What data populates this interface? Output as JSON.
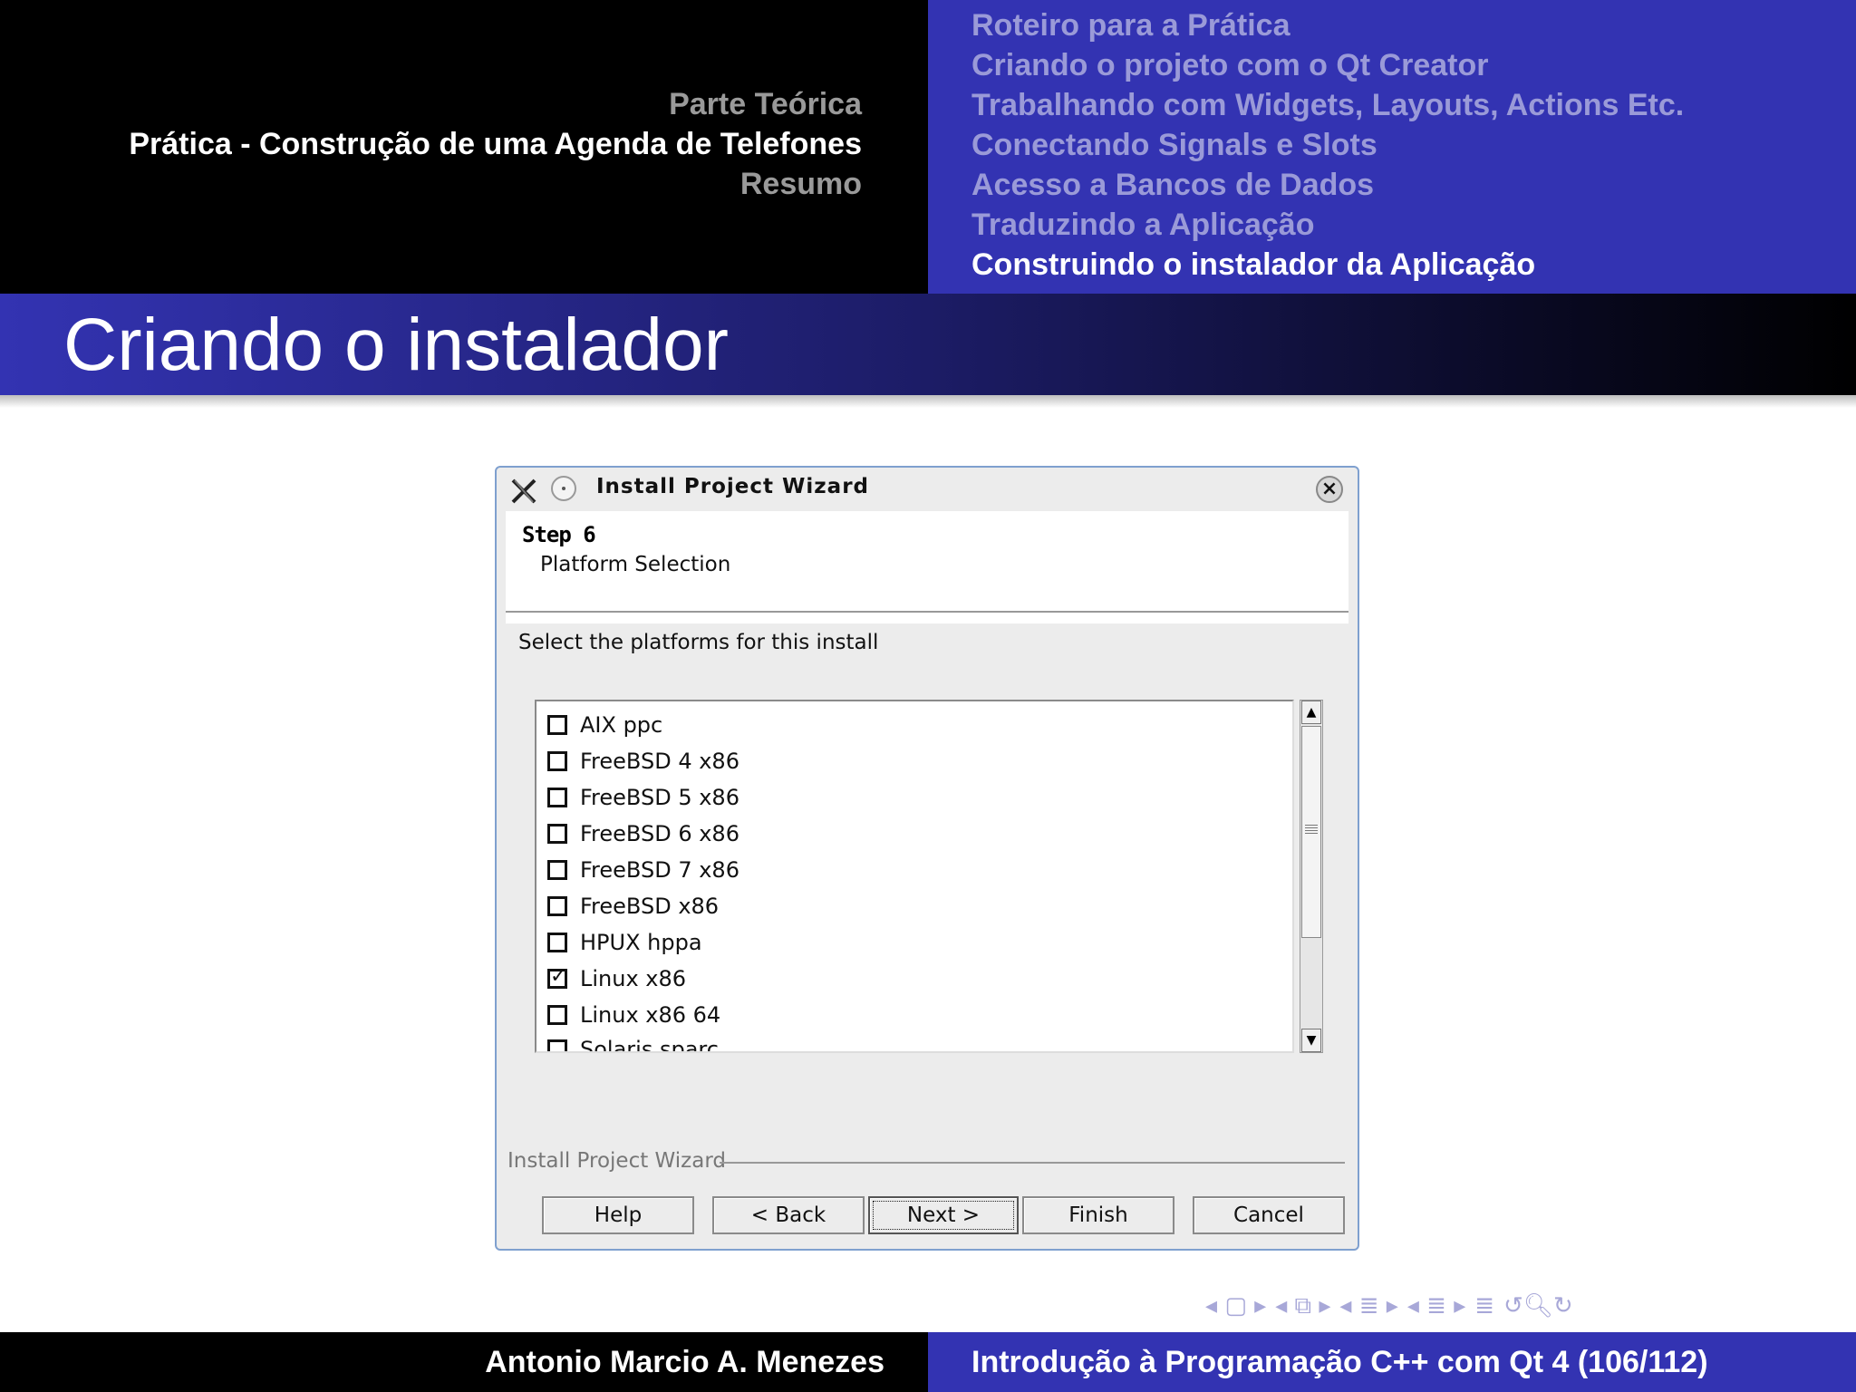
{
  "header": {
    "sections": [
      {
        "label": "Parte Teórica",
        "active": false
      },
      {
        "label": "Prática - Construção de uma Agenda de Telefones",
        "active": true
      },
      {
        "label": "Resumo",
        "active": false
      }
    ],
    "subsections": [
      {
        "label": "Roteiro para a Prática",
        "active": false
      },
      {
        "label": "Criando o projeto com o Qt Creator",
        "active": false
      },
      {
        "label": "Trabalhando com Widgets, Layouts, Actions Etc.",
        "active": false
      },
      {
        "label": "Conectando Signals e Slots",
        "active": false
      },
      {
        "label": "Acesso a Bancos de Dados",
        "active": false
      },
      {
        "label": "Traduzindo a Aplicação",
        "active": false
      },
      {
        "label": "Construindo o instalador da Aplicação",
        "active": true
      }
    ]
  },
  "frame": {
    "title": "Criando o instalador"
  },
  "dialog": {
    "title": "Install Project Wizard",
    "step_title": "Step 6",
    "step_subtitle": "Platform Selection",
    "prompt": "Select the platforms for this install",
    "platforms": [
      {
        "label": "AIX ppc",
        "checked": false
      },
      {
        "label": "FreeBSD 4 x86",
        "checked": false
      },
      {
        "label": "FreeBSD 5 x86",
        "checked": false
      },
      {
        "label": "FreeBSD 6 x86",
        "checked": false
      },
      {
        "label": "FreeBSD 7 x86",
        "checked": false
      },
      {
        "label": "FreeBSD x86",
        "checked": false
      },
      {
        "label": "HPUX hppa",
        "checked": false
      },
      {
        "label": "Linux x86",
        "checked": true
      },
      {
        "label": "Linux x86 64",
        "checked": false
      },
      {
        "label": "Solaris sparc",
        "checked": false
      }
    ],
    "group_label": "Install Project Wizard",
    "buttons": {
      "help": "Help",
      "back": "< Back",
      "next": "Next >",
      "finish": "Finish",
      "cancel": "Cancel"
    }
  },
  "footer": {
    "author": "Antonio Marcio A. Menezes",
    "title": "Introdução à Programação C++ com Qt 4 (106/112)"
  },
  "colors": {
    "beamer_blue": "#3333b2",
    "inactive_section": "#9a9a9a",
    "inactive_subsection": "#9a9ad8"
  }
}
